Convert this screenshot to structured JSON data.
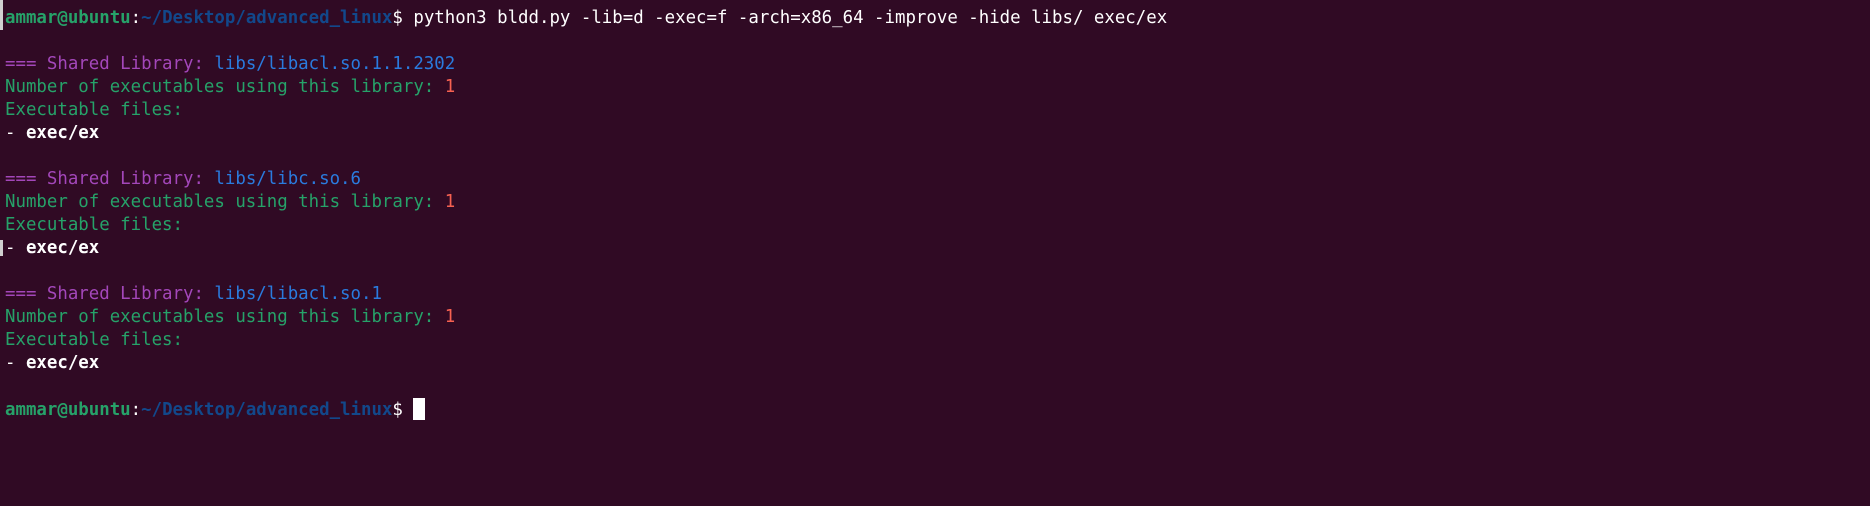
{
  "colors": {
    "background": "#300a24",
    "user_host": "#26a269",
    "path": "#12488b",
    "header": "#a347ba",
    "lib_path": "#2a7bde",
    "count": "#f66151",
    "label": "#26a269",
    "text": "#ffffff"
  },
  "terminal": {
    "lines": [
      [
        {
          "t": "ammar@ubuntu",
          "c": "user_host",
          "b": true
        },
        {
          "t": ":",
          "c": "text"
        },
        {
          "t": "~/Desktop/advanced_linux",
          "c": "path",
          "b": true
        },
        {
          "t": "$ python3 bldd.py -lib=d -exec=f -arch=x86_64 -improve -hide libs/ exec/ex",
          "c": "text"
        }
      ],
      [],
      [
        {
          "t": "=== Shared Library: ",
          "c": "header"
        },
        {
          "t": "libs/libacl.so.1.1.2302",
          "c": "lib_path"
        }
      ],
      [
        {
          "t": "Number of executables using this library: ",
          "c": "label"
        },
        {
          "t": "1",
          "c": "count"
        }
      ],
      [
        {
          "t": "Executable files:",
          "c": "label"
        }
      ],
      [
        {
          "t": "- ",
          "c": "text"
        },
        {
          "t": "exec/ex",
          "c": "text",
          "b": true
        }
      ],
      [],
      [
        {
          "t": "=== Shared Library: ",
          "c": "header"
        },
        {
          "t": "libs/libc.so.6",
          "c": "lib_path"
        }
      ],
      [
        {
          "t": "Number of executables using this library: ",
          "c": "label"
        },
        {
          "t": "1",
          "c": "count"
        }
      ],
      [
        {
          "t": "Executable files:",
          "c": "label"
        }
      ],
      [
        {
          "t": "- ",
          "c": "text"
        },
        {
          "t": "exec/ex",
          "c": "text",
          "b": true
        }
      ],
      [],
      [
        {
          "t": "=== Shared Library: ",
          "c": "header"
        },
        {
          "t": "libs/libacl.so.1",
          "c": "lib_path"
        }
      ],
      [
        {
          "t": "Number of executables using this library: ",
          "c": "label"
        },
        {
          "t": "1",
          "c": "count"
        }
      ],
      [
        {
          "t": "Executable files:",
          "c": "label"
        }
      ],
      [
        {
          "t": "- ",
          "c": "text"
        },
        {
          "t": "exec/ex",
          "c": "text",
          "b": true
        }
      ],
      [],
      [
        {
          "t": "ammar@ubuntu",
          "c": "user_host",
          "b": true
        },
        {
          "t": ":",
          "c": "text"
        },
        {
          "t": "~/Desktop/advanced_linux",
          "c": "path",
          "b": true
        },
        {
          "t": "$ ",
          "c": "text"
        }
      ]
    ]
  }
}
